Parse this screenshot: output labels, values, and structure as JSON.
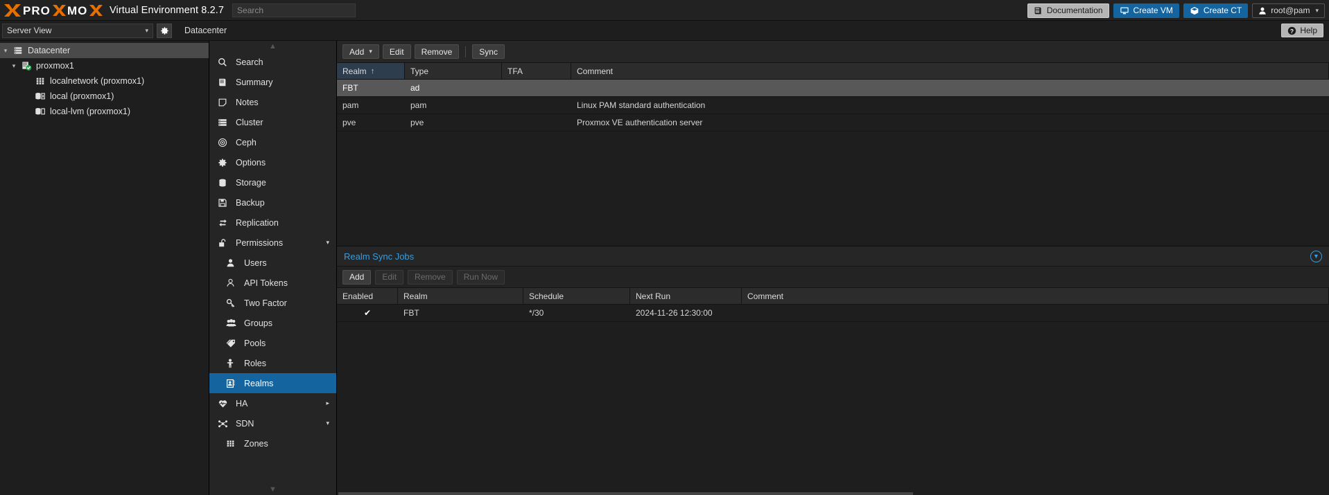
{
  "header": {
    "brand": "PROXMOX",
    "product": "Virtual Environment 8.2.7",
    "search_placeholder": "Search",
    "search_value": "",
    "documentation_label": "Documentation",
    "create_vm_label": "Create VM",
    "create_ct_label": "Create CT",
    "user_label": "root@pam",
    "accent_blue": "#1464a0",
    "brand_orange": "#e57000"
  },
  "subbar": {
    "view_selector_value": "Server View",
    "breadcrumb": "Datacenter",
    "help_label": "Help"
  },
  "tree": {
    "items": [
      {
        "label": "Datacenter",
        "icon": "datacenter-icon",
        "level": 0,
        "arrow": "down",
        "selected": true
      },
      {
        "label": "proxmox1",
        "icon": "node-online-icon",
        "level": 1,
        "arrow": "down",
        "selected": false
      },
      {
        "label": "localnetwork (proxmox1)",
        "icon": "network-grid-icon",
        "level": 2,
        "arrow": "none",
        "selected": false
      },
      {
        "label": "local (proxmox1)",
        "icon": "storage-icon",
        "level": 2,
        "arrow": "none",
        "selected": false
      },
      {
        "label": "local-lvm (proxmox1)",
        "icon": "storage-icon",
        "level": 2,
        "arrow": "none",
        "selected": false
      }
    ]
  },
  "nav": {
    "items": [
      {
        "label": "Search",
        "icon": "search-icon",
        "sub": false,
        "active": false,
        "expander": ""
      },
      {
        "label": "Summary",
        "icon": "summary-icon",
        "sub": false,
        "active": false,
        "expander": ""
      },
      {
        "label": "Notes",
        "icon": "notes-icon",
        "sub": false,
        "active": false,
        "expander": ""
      },
      {
        "label": "Cluster",
        "icon": "cluster-icon",
        "sub": false,
        "active": false,
        "expander": ""
      },
      {
        "label": "Ceph",
        "icon": "ceph-icon",
        "sub": false,
        "active": false,
        "expander": ""
      },
      {
        "label": "Options",
        "icon": "gear-icon",
        "sub": false,
        "active": false,
        "expander": ""
      },
      {
        "label": "Storage",
        "icon": "storage-icon",
        "sub": false,
        "active": false,
        "expander": ""
      },
      {
        "label": "Backup",
        "icon": "backup-icon",
        "sub": false,
        "active": false,
        "expander": ""
      },
      {
        "label": "Replication",
        "icon": "replication-icon",
        "sub": false,
        "active": false,
        "expander": ""
      },
      {
        "label": "Permissions",
        "icon": "unlock-icon",
        "sub": false,
        "active": false,
        "expander": "down"
      },
      {
        "label": "Users",
        "icon": "user-icon",
        "sub": true,
        "active": false,
        "expander": ""
      },
      {
        "label": "API Tokens",
        "icon": "api-token-icon",
        "sub": true,
        "active": false,
        "expander": ""
      },
      {
        "label": "Two Factor",
        "icon": "key-icon",
        "sub": true,
        "active": false,
        "expander": ""
      },
      {
        "label": "Groups",
        "icon": "groups-icon",
        "sub": true,
        "active": false,
        "expander": ""
      },
      {
        "label": "Pools",
        "icon": "pool-tag-icon",
        "sub": true,
        "active": false,
        "expander": ""
      },
      {
        "label": "Roles",
        "icon": "roles-icon",
        "sub": true,
        "active": false,
        "expander": ""
      },
      {
        "label": "Realms",
        "icon": "realms-icon",
        "sub": true,
        "active": true,
        "expander": ""
      },
      {
        "label": "HA",
        "icon": "ha-heartbeat-icon",
        "sub": false,
        "active": false,
        "expander": "right"
      },
      {
        "label": "SDN",
        "icon": "sdn-icon",
        "sub": false,
        "active": false,
        "expander": "down"
      },
      {
        "label": "Zones",
        "icon": "network-grid-icon",
        "sub": true,
        "active": false,
        "expander": ""
      }
    ]
  },
  "realms": {
    "toolbar": {
      "add_label": "Add",
      "edit_label": "Edit",
      "remove_label": "Remove",
      "sync_label": "Sync"
    },
    "columns": [
      "Realm",
      "Type",
      "TFA",
      "Comment"
    ],
    "sort_column": "Realm",
    "sort_direction": "asc",
    "rows": [
      {
        "realm": "FBT",
        "type": "ad",
        "tfa": "",
        "comment": "",
        "selected": true
      },
      {
        "realm": "pam",
        "type": "pam",
        "tfa": "",
        "comment": "Linux PAM standard authentication",
        "selected": false
      },
      {
        "realm": "pve",
        "type": "pve",
        "tfa": "",
        "comment": "Proxmox VE authentication server",
        "selected": false
      }
    ]
  },
  "sync_jobs": {
    "title": "Realm Sync Jobs",
    "toolbar": {
      "add_label": "Add",
      "edit_label": "Edit",
      "remove_label": "Remove",
      "run_now_label": "Run Now"
    },
    "columns": [
      "Enabled",
      "Realm",
      "Schedule",
      "Next Run",
      "Comment"
    ],
    "rows": [
      {
        "enabled": "✔",
        "realm": "FBT",
        "schedule": "*/30",
        "next_run": "2024-11-26 12:30:00",
        "comment": ""
      }
    ]
  }
}
